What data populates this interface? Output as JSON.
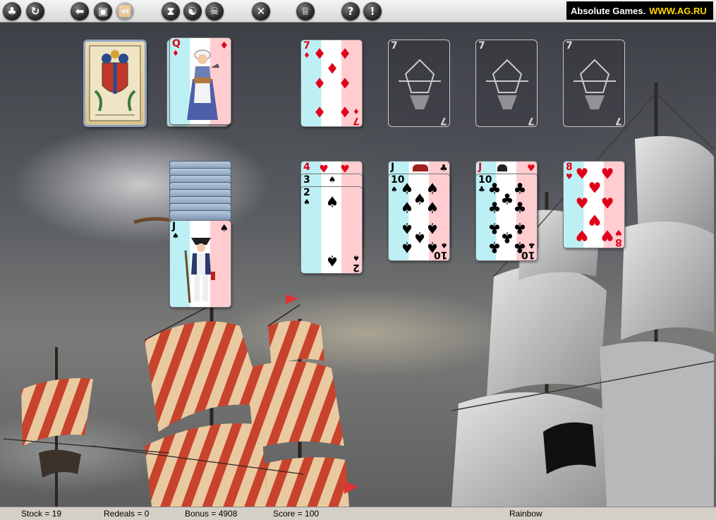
{
  "toolbar": {
    "buttons": [
      {
        "name": "clubs-menu-icon",
        "glyph": "♣"
      },
      {
        "name": "restart-icon",
        "glyph": "↻"
      },
      {
        "name": "undo-icon",
        "glyph": "⬅"
      },
      {
        "name": "camera-icon",
        "glyph": "▣"
      },
      {
        "name": "fast-back-icon",
        "glyph": "⏪"
      },
      {
        "name": "hourglass-icon",
        "glyph": "⧗"
      },
      {
        "name": "yin-yang-icon",
        "glyph": "☯"
      },
      {
        "name": "skull-icon",
        "glyph": "☠"
      },
      {
        "name": "tools-icon",
        "glyph": "✕"
      },
      {
        "name": "trophy-icon",
        "glyph": "♕"
      },
      {
        "name": "help-icon",
        "glyph": "?"
      },
      {
        "name": "hint-icon",
        "glyph": "!"
      }
    ],
    "brand_text": "Absolute Games.",
    "brand_url": "WWW.AG.RU"
  },
  "cards": {
    "waste_top": {
      "rank": "Q",
      "suit": "♦",
      "color": "#e0001a"
    },
    "foundation_1": {
      "rank": "7",
      "suit": "♦",
      "color": "#e0001a"
    },
    "foundation_empty": [
      {
        "rank": "7"
      },
      {
        "rank": "7"
      },
      {
        "rank": "7"
      }
    ],
    "tableau_1": {
      "rank": "J",
      "suit": "♠"
    },
    "tableau_2": [
      {
        "rank": "4",
        "suit": "♥"
      },
      {
        "rank": "3",
        "suit": "♠"
      },
      {
        "rank": "2",
        "suit": "♠"
      }
    ],
    "tableau_3": [
      {
        "rank": "J",
        "suit": "♣"
      },
      {
        "rank": "10",
        "suit": "♠"
      }
    ],
    "tableau_4": [
      {
        "rank": "J",
        "suit": "♥"
      },
      {
        "rank": "10",
        "suit": "♣"
      }
    ],
    "tableau_5": {
      "rank": "8",
      "suit": "♥"
    }
  },
  "status": {
    "stock": "Stock = 19",
    "redeals": "Redeals = 0",
    "bonus": "Bonus = 4908",
    "score": "Score = 100",
    "mode": "Rainbow"
  }
}
